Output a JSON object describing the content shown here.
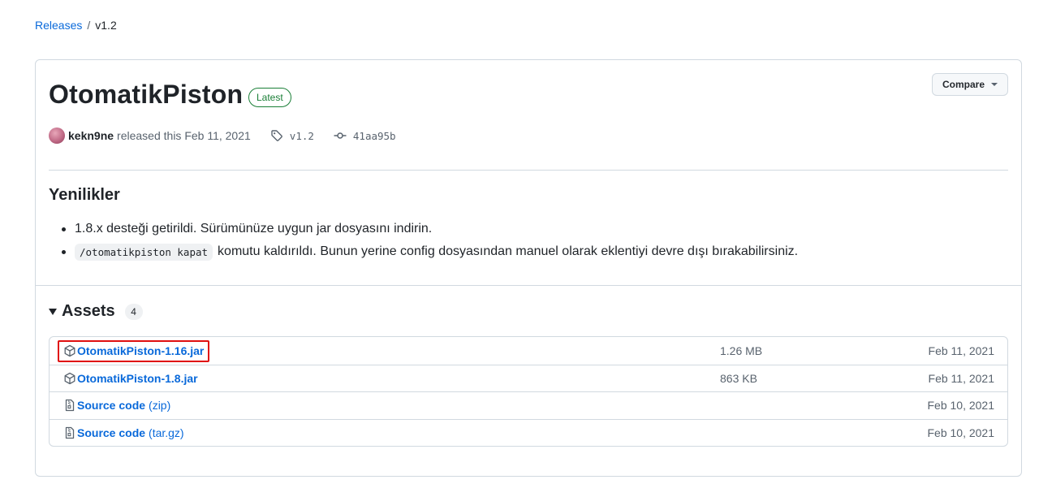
{
  "breadcrumb": {
    "root": "Releases",
    "separator": "/",
    "current": "v1.2"
  },
  "release": {
    "title": "OtomatikPiston",
    "badge": "Latest",
    "compare_label": "Compare",
    "author": "kekn9ne",
    "released_text": "released this Feb 11, 2021",
    "tag": "v1.2",
    "commit": "41aa95b"
  },
  "notes": {
    "heading": "Yenilikler",
    "items": [
      {
        "text": "1.8.x desteği getirildi. Sürümünüze uygun jar dosyasını indirin."
      },
      {
        "code": "/otomatikpiston kapat",
        "text": "komutu kaldırıldı. Bunun yerine config dosyasından manuel olarak eklentiyi devre dışı bırakabilirsiniz."
      }
    ]
  },
  "assets": {
    "title": "Assets",
    "count": "4",
    "rows": [
      {
        "name": "OtomatikPiston-1.16.jar",
        "size": "1.26 MB",
        "date": "Feb 11, 2021",
        "icon": "package-icon",
        "highlighted": true
      },
      {
        "name": "OtomatikPiston-1.8.jar",
        "size": "863 KB",
        "date": "Feb 11, 2021",
        "icon": "package-icon"
      },
      {
        "name": "Source code",
        "suffix": "(zip)",
        "date": "Feb 10, 2021",
        "icon": "file-zip-icon"
      },
      {
        "name": "Source code",
        "suffix": "(tar.gz)",
        "date": "Feb 10, 2021",
        "icon": "file-zip-icon"
      }
    ]
  },
  "colors": {
    "link": "#0969da",
    "latest_badge": "#1a7f37",
    "highlight_box": "#e01010",
    "border": "#d1d9e0",
    "muted_text": "#59636e"
  }
}
